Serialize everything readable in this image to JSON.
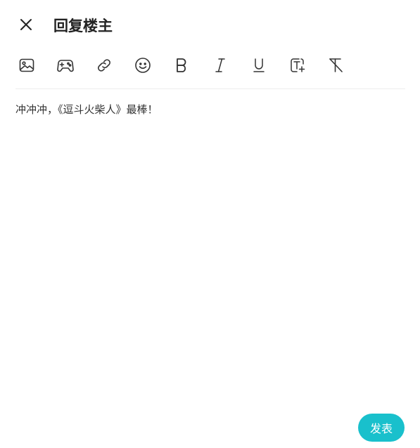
{
  "header": {
    "title": "回复楼主",
    "close_icon": "close-icon"
  },
  "toolbar": {
    "items": [
      {
        "name": "image",
        "icon": "image-icon"
      },
      {
        "name": "game",
        "icon": "gamepad-icon"
      },
      {
        "name": "link",
        "icon": "link-icon"
      },
      {
        "name": "emoji",
        "icon": "smiley-icon"
      },
      {
        "name": "bold",
        "icon": "bold-icon",
        "glyph": "B"
      },
      {
        "name": "italic",
        "icon": "italic-icon",
        "glyph": "I"
      },
      {
        "name": "underline",
        "icon": "underline-icon",
        "glyph": "U"
      },
      {
        "name": "font-size",
        "icon": "text-size-icon"
      },
      {
        "name": "clear-format",
        "icon": "clear-format-icon"
      }
    ]
  },
  "editor": {
    "content": "冲冲冲，《逗斗火柴人》最棒！"
  },
  "footer": {
    "submit_label": "发表"
  },
  "colors": {
    "accent": "#19c0cc",
    "icon": "#333333",
    "divider": "#ececec"
  }
}
